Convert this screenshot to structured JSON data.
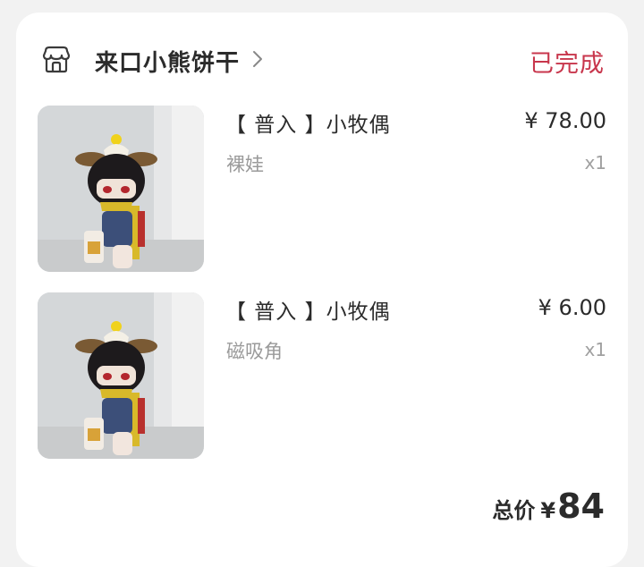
{
  "order": {
    "shop_name": "来口小熊饼干",
    "status": "已完成",
    "status_color": "#c8364c",
    "icons": {
      "shop": "shop-icon",
      "chevron": "chevron-right-icon"
    }
  },
  "items": [
    {
      "title": "【 普入 】小牧偶",
      "spec": "裸娃",
      "price": "¥ 78.00",
      "qty": "x1",
      "image": "plush-doll-photo"
    },
    {
      "title": "【 普入 】小牧偶",
      "spec": "磁吸角",
      "price": "¥ 6.00",
      "qty": "x1",
      "image": "plush-doll-photo"
    }
  ],
  "total": {
    "label": "总价",
    "currency": "¥",
    "value": "84"
  }
}
